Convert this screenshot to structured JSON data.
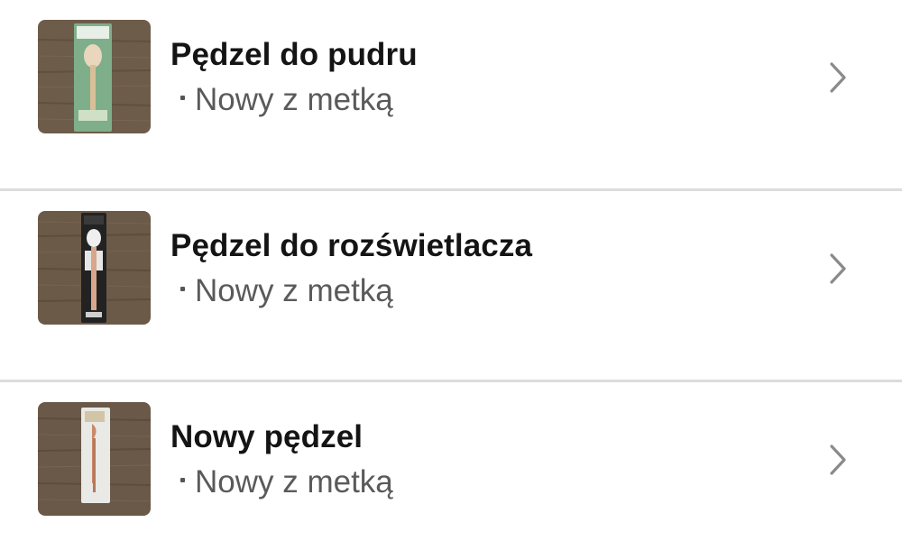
{
  "items": [
    {
      "title": "Pędzel do pudru",
      "condition": "Nowy z metką",
      "thumbnail": "powder-brush-photo",
      "package_color": "#7fae8a"
    },
    {
      "title": "Pędzel do rozświetlacza",
      "condition": "Nowy z metką",
      "thumbnail": "highlighter-brush-photo",
      "package_color": "#222222"
    },
    {
      "title": "Nowy pędzel",
      "condition": "Nowy z metką",
      "thumbnail": "brush-photo",
      "package_color": "#e9e9e6"
    }
  ],
  "icons": {
    "chevron": "chevron-right-icon"
  },
  "colors": {
    "title": "#141414",
    "subtitle": "#5a5a5a",
    "chevron": "#8a8a8a",
    "divider": "#dcdcdc",
    "wood": "#6b5a48"
  }
}
